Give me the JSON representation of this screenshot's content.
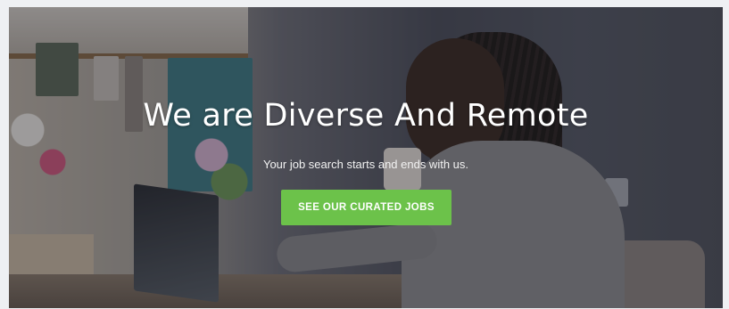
{
  "hero": {
    "title": "We are Diverse And Remote",
    "subtitle": "Your job search starts and ends with us.",
    "cta_label": "SEE OUR CURATED JOBS",
    "cta_color": "#6cc24a"
  }
}
